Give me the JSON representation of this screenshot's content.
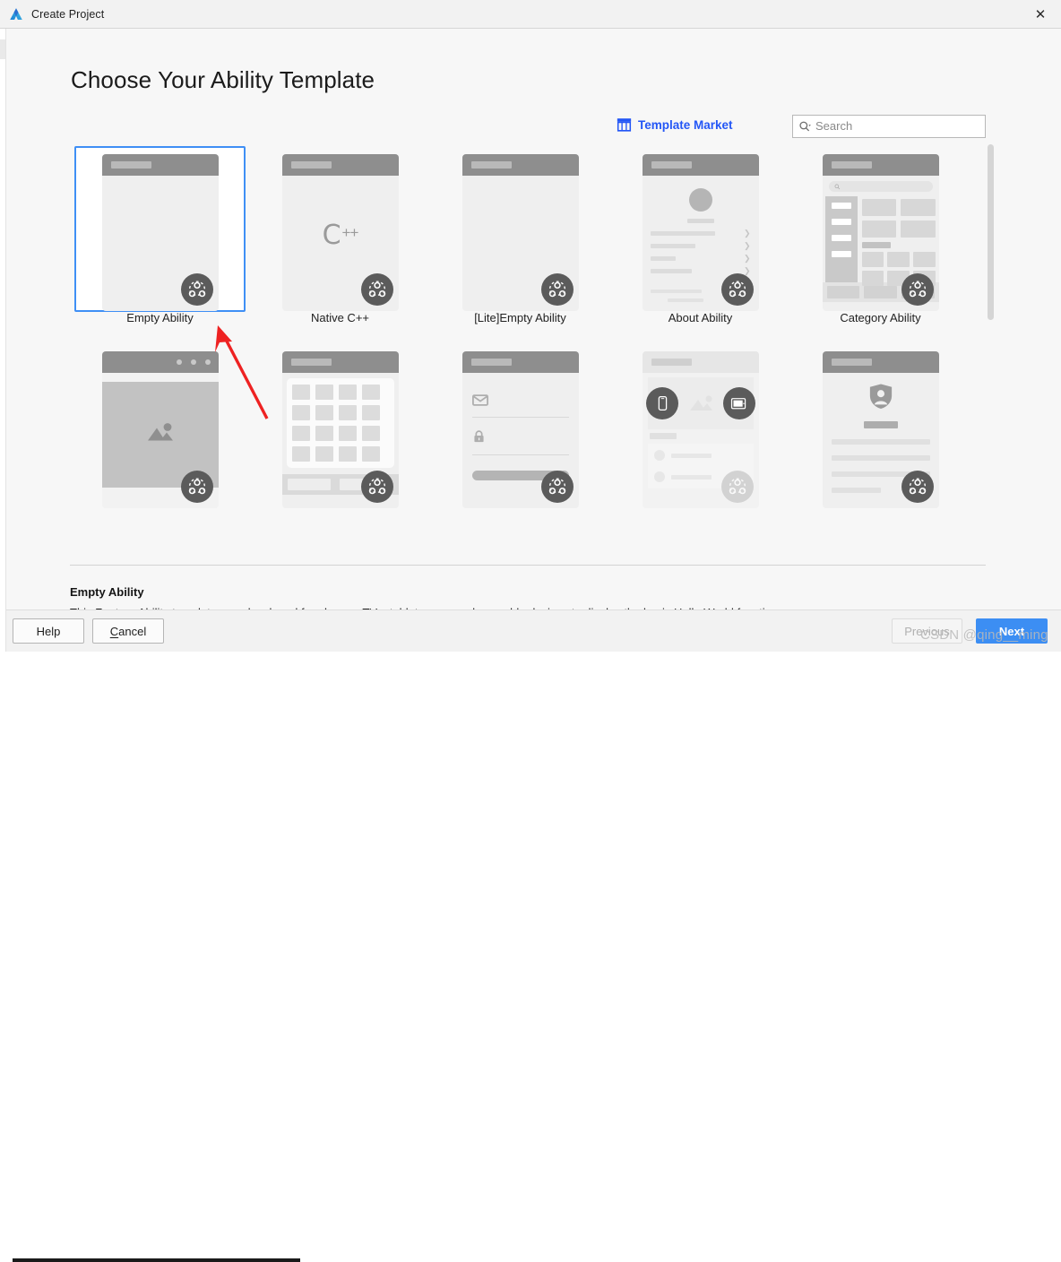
{
  "window": {
    "title": "Create Project",
    "app_icon": "deveco-logo-icon",
    "close_label": "✕"
  },
  "page": {
    "heading": "Choose Your Ability Template"
  },
  "toolbar": {
    "market_label": "Template Market",
    "market_icon": "storefront-icon",
    "search_icon": "search-dropdown-icon",
    "search_value": "",
    "search_placeholder": "Search"
  },
  "templates": [
    {
      "label": "Empty Ability",
      "selected": true,
      "dimmed": false
    },
    {
      "label": "Native C++",
      "selected": false,
      "dimmed": false
    },
    {
      "label": "[Lite]Empty Ability",
      "selected": false,
      "dimmed": false
    },
    {
      "label": "About Ability",
      "selected": false,
      "dimmed": false
    },
    {
      "label": "Category Ability",
      "selected": false,
      "dimmed": false
    },
    {
      "label": "",
      "selected": false,
      "dimmed": false
    },
    {
      "label": "",
      "selected": false,
      "dimmed": false
    },
    {
      "label": "",
      "selected": false,
      "dimmed": false
    },
    {
      "label": "",
      "selected": false,
      "dimmed": true
    },
    {
      "label": "",
      "selected": false,
      "dimmed": false
    }
  ],
  "description": {
    "title": "Empty Ability",
    "body": "This Feature Ability template was developed for phones, TVs, tablets, cars and wearable devices to display the basic Hello World functions."
  },
  "footer": {
    "help_label": "Help",
    "cancel_label_mnemonic": "C",
    "cancel_label_rest": "ancel",
    "previous_label": "Previous",
    "next_label": "Next"
  },
  "annotation": {
    "arrow_color": "#ee2222"
  },
  "watermark": {
    "text": "CSDN @qing__ming"
  },
  "colors": {
    "accent_blue": "#3c8ef3",
    "link_blue": "#2356f6",
    "selection_border": "#3f8ff5",
    "mock_header_gray": "#8e8e8e",
    "badge_gray": "#5b5b5b"
  }
}
